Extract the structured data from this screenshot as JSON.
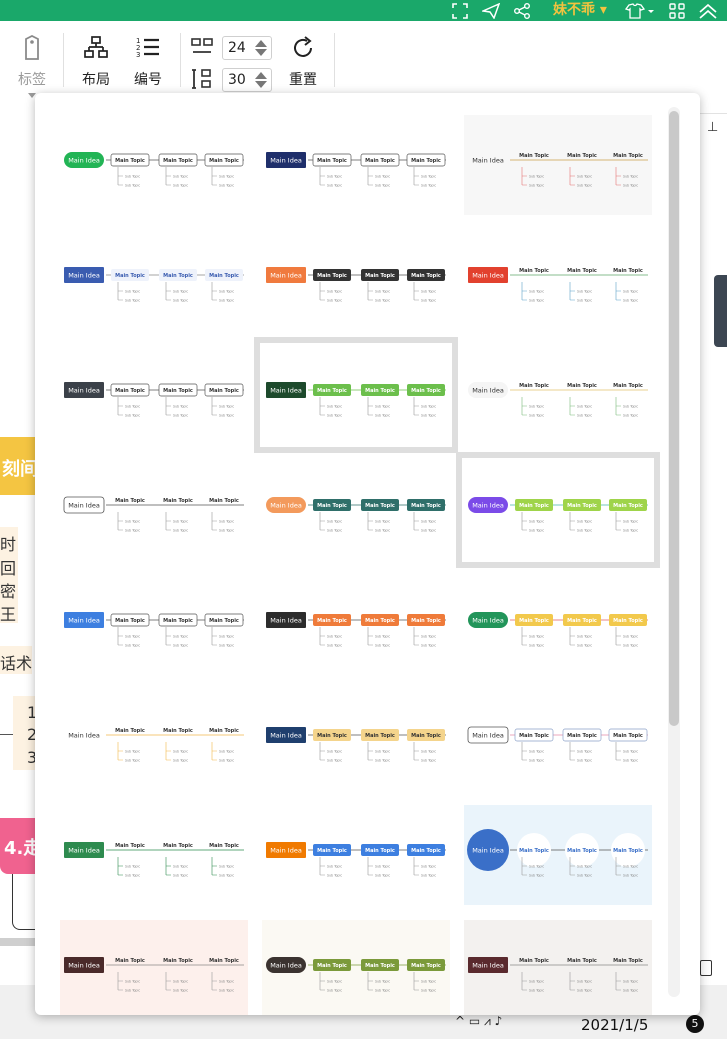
{
  "topbar": {
    "user_name": "妹不乖 ▾",
    "icons": [
      "fullscreen-icon",
      "send-icon",
      "share-icon",
      "shirt-icon",
      "apps-icon",
      "collapse-up-icon"
    ]
  },
  "toolbar": {
    "tag_label": "标签",
    "layout_label": "布局",
    "numbering_label": "编号",
    "spacing_h_value": "24",
    "spacing_v_value": "30",
    "reset_label": "重置"
  },
  "background": {
    "fragments": [
      "刻间",
      "时",
      "回",
      "密",
      "王",
      "话术",
      "1",
      "2",
      "3",
      "4.走"
    ]
  },
  "taskbar": {
    "date": "2021/1/5",
    "notification_count": "5"
  },
  "labels": {
    "main_idea": "Main Idea",
    "main_topic": "Main Topic",
    "sub_topic": "Sub Topic"
  },
  "colors": {
    "accent_green": "#1aa86a",
    "user_gold": "#f3c33f",
    "selected_border": "#dedede"
  },
  "themes": [
    {
      "root": "#22b455",
      "rootText": "#ffffff",
      "rootShape": "pill",
      "topic": "#ffffff",
      "topicText": "#333333",
      "topicBorder": "#555555",
      "line": "#555555",
      "sub": "#999999",
      "bg": "#ffffff"
    },
    {
      "root": "#1f2f6b",
      "rootText": "#ffffff",
      "rootShape": "rect",
      "topic": "#ffffff",
      "topicText": "#333333",
      "topicBorder": "#555555",
      "line": "#555555",
      "sub": "#999999",
      "bg": "#ffffff"
    },
    {
      "root": "#ffffff",
      "rootText": "#333333",
      "rootShape": "plain",
      "topic": "none",
      "topicText": "#333333",
      "topicBorder": "none",
      "line": "#c9a04a",
      "sub": "#e57373",
      "bg": "#f7f7f7"
    },
    {
      "root": "#3a5cb0",
      "rootText": "#ffffff",
      "rootShape": "rect",
      "topic": "#eef2fb",
      "topicText": "#3a5cb0",
      "topicBorder": "none",
      "line": "#888888",
      "sub": "#999999",
      "bg": "#ffffff"
    },
    {
      "root": "#f07a3e",
      "rootText": "#ffffff",
      "rootShape": "rect",
      "topic": "#333333",
      "topicText": "#ffffff",
      "topicBorder": "none",
      "line": "#555555",
      "sub": "#999999",
      "bg": "#ffffff"
    },
    {
      "root": "#e2412e",
      "rootText": "#ffffff",
      "rootShape": "rect",
      "topic": "none",
      "topicText": "#333333",
      "topicBorder": "none",
      "line": "#5fa96a",
      "sub": "#5fa2c9",
      "bg": "#ffffff"
    },
    {
      "root": "#3b4149",
      "rootText": "#ffffff",
      "rootShape": "rect",
      "topic": "#ffffff",
      "topicText": "#333333",
      "topicBorder": "#555555",
      "line": "#555555",
      "sub": "#999999",
      "bg": "#ffffff"
    },
    {
      "root": "#1d4a2c",
      "rootText": "#ffffff",
      "rootShape": "rect",
      "topic": "#6cbf4c",
      "topicText": "#ffffff",
      "topicBorder": "none",
      "line": "#6cbf4c",
      "sub": "#999999",
      "bg": "#ffffff"
    },
    {
      "root": "#ffffff",
      "rootText": "#333333",
      "rootShape": "pill-soft",
      "topic": "none",
      "topicText": "#333333",
      "topicBorder": "none",
      "line": "#e3c26b",
      "sub": "#7ab97a",
      "bg": "#ffffff"
    },
    {
      "root": "#ffffff",
      "rootText": "#333333",
      "rootShape": "outline",
      "topic": "none",
      "topicText": "#333333",
      "topicBorder": "none",
      "line": "#555555",
      "sub": "#999999",
      "bg": "#ffffff"
    },
    {
      "root": "#f39a5c",
      "rootText": "#ffffff",
      "rootShape": "pill",
      "topic": "#2f6f6a",
      "topicText": "#ffffff",
      "topicBorder": "none",
      "line": "#2f6f6a",
      "sub": "#999999",
      "bg": "#ffffff"
    },
    {
      "root": "#7b4be8",
      "rootText": "#ffffff",
      "rootShape": "pill",
      "topic": "#9fd44a",
      "topicText": "#ffffff",
      "topicBorder": "none",
      "line": "#45b8a6",
      "sub": "#999999",
      "bg": "#ffffff"
    },
    {
      "root": "#3d7fe0",
      "rootText": "#ffffff",
      "rootShape": "hex",
      "topic": "#ffffff",
      "topicText": "#333333",
      "topicBorder": "#555555",
      "line": "#555555",
      "sub": "#999999",
      "bg": "#ffffff"
    },
    {
      "root": "#2c2c2c",
      "rootText": "#ffffff",
      "rootShape": "rect",
      "topic": "#ef7b3a",
      "topicText": "#ffffff",
      "topicBorder": "none",
      "line": "#555555",
      "sub": "#999999",
      "bg": "#ffffff"
    },
    {
      "root": "#22955a",
      "rootText": "#ffffff",
      "rootShape": "pill",
      "topic": "#f2c94c",
      "topicText": "#ffffff",
      "topicBorder": "none",
      "line": "#e35d5d",
      "sub": "#999999",
      "bg": "#ffffff"
    },
    {
      "root": "#ffffff",
      "rootText": "#333333",
      "rootShape": "plain",
      "topic": "none",
      "topicText": "#333333",
      "topicBorder": "none",
      "line": "#f2b84b",
      "sub": "#f2b84b",
      "bg": "#ffffff"
    },
    {
      "root": "#1f3f6e",
      "rootText": "#ffffff",
      "rootShape": "rect",
      "topic": "#f4d48c",
      "topicText": "#333333",
      "topicBorder": "none",
      "line": "#555555",
      "sub": "#999999",
      "bg": "#ffffff"
    },
    {
      "root": "#ffffff",
      "rootText": "#333333",
      "rootShape": "outline",
      "topic": "#ffffff",
      "topicText": "#333333",
      "topicBorder": "#8aa0c8",
      "line": "#e48aa8",
      "sub": "#999999",
      "bg": "#ffffff"
    },
    {
      "root": "#2e8b4f",
      "rootText": "#ffffff",
      "rootShape": "rect",
      "topic": "none",
      "topicText": "#333333",
      "topicBorder": "none",
      "line": "#2e8b4f",
      "sub": "#2e8b4f",
      "bg": "#ffffff"
    },
    {
      "root": "#f07a00",
      "rootText": "#ffffff",
      "rootShape": "rect",
      "topic": "#3d7fe0",
      "topicText": "#ffffff",
      "topicBorder": "none",
      "line": "#555555",
      "sub": "#999999",
      "bg": "#ffffff"
    },
    {
      "root": "#3a6fc8",
      "rootText": "#ffffff",
      "rootShape": "circle",
      "topic": "#ffffff",
      "topicText": "#3a6fc8",
      "topicBorder": "none",
      "line": "#555555",
      "sub": "#999999",
      "bg": "#eaf4fb"
    },
    {
      "root": "#4a2a2a",
      "rootText": "#ffffff",
      "rootShape": "rect",
      "topic": "none",
      "topicText": "#333333",
      "topicBorder": "none",
      "line": "#888888",
      "sub": "#999999",
      "bg": "#fdf0ec"
    },
    {
      "root": "#3b3330",
      "rootText": "#ffffff",
      "rootShape": "pill",
      "topic": "#7b9a3a",
      "topicText": "#ffffff",
      "topicBorder": "none",
      "line": "#7b9a3a",
      "sub": "#999999",
      "bg": "#fbf9f3"
    },
    {
      "root": "#5a2a2e",
      "rootText": "#ffffff",
      "rootShape": "rect",
      "topic": "none",
      "topicText": "#333333",
      "topicBorder": "none",
      "line": "#888888",
      "sub": "#999999",
      "bg": "#f3f1ef"
    }
  ],
  "selected_indices": [
    7,
    11
  ]
}
